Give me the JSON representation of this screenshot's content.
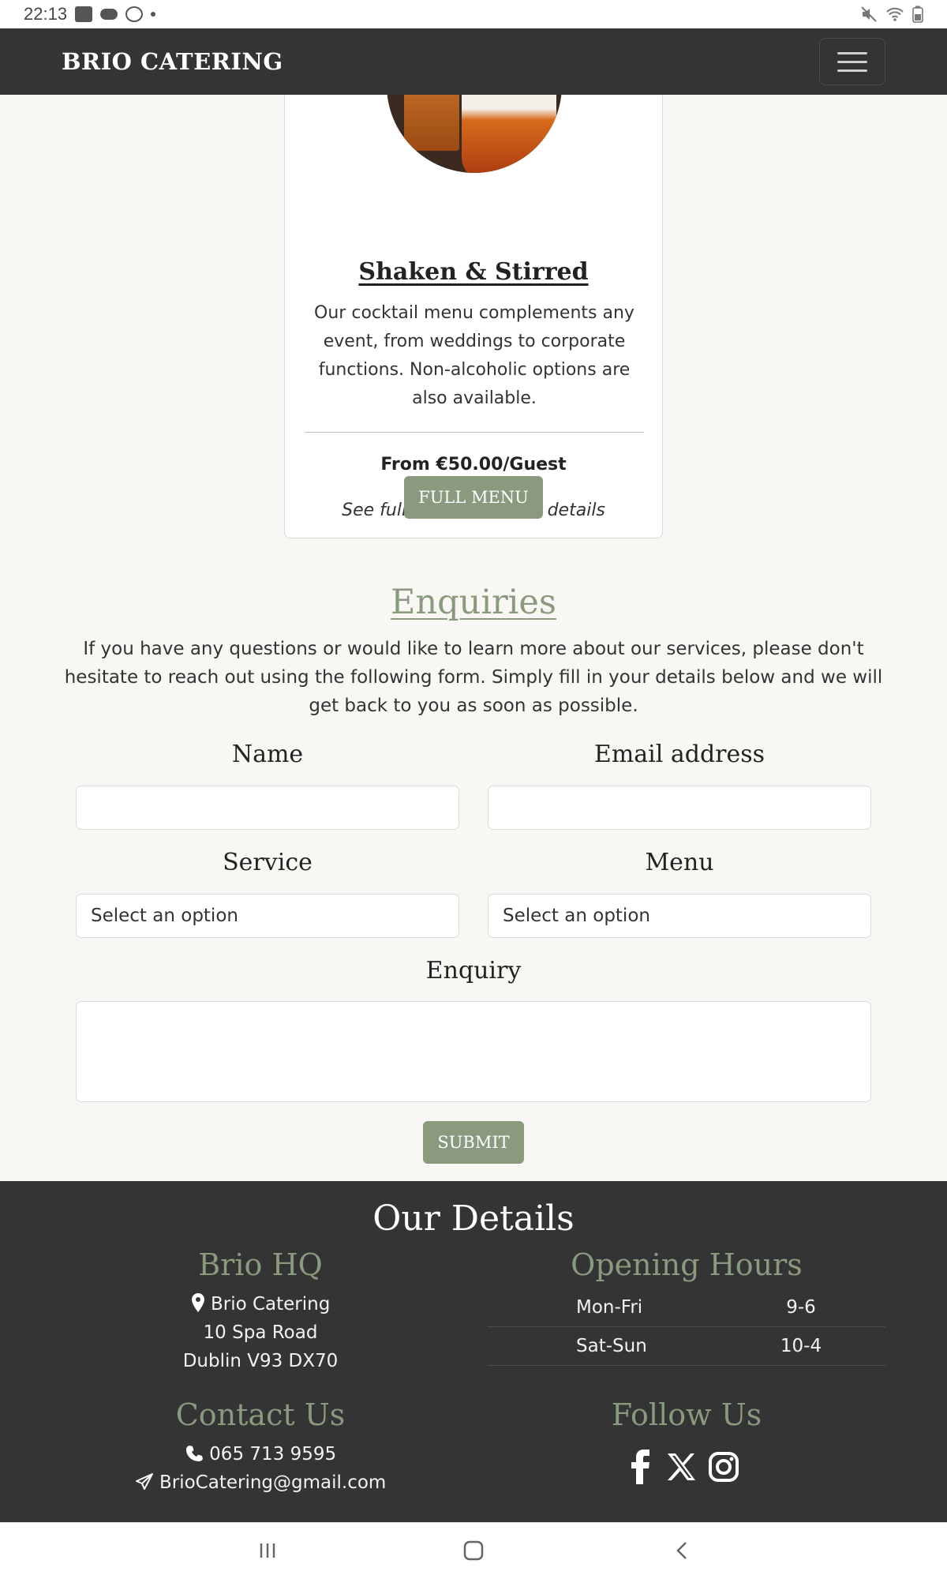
{
  "status_bar": {
    "time": "22:13"
  },
  "navbar": {
    "brand": "BRIO CATERING"
  },
  "menu_card": {
    "title": "Shaken & Stirred",
    "description": "Our cocktail menu complements any event, from weddings to corporate functions. Non-alcoholic options are also available.",
    "price": "From €50.00/Guest",
    "note": "See full menu for more details",
    "button_label": "FULL MENU"
  },
  "enquiries": {
    "title": "Enquiries",
    "intro": "If you have any questions or would like to learn more about our services, please don't hesitate to reach out using the following form. Simply fill in your details below and we will get back to you as soon as possible.",
    "name_label": "Name",
    "email_label": "Email address",
    "service_label": "Service",
    "service_value": "Select an option",
    "menu_label": "Menu",
    "menu_value": "Select an option",
    "enquiry_label": "Enquiry",
    "submit_label": "SUBMIT"
  },
  "footer": {
    "title": "Our Details",
    "hq": {
      "heading": "Brio HQ",
      "lines": [
        "Brio Catering",
        "10 Spa Road",
        "Dublin V93 DX70"
      ]
    },
    "hours": {
      "heading": "Opening Hours",
      "rows": [
        {
          "day": "Mon-Fri",
          "time": "9-6"
        },
        {
          "day": "Sat-Sun",
          "time": "10-4"
        }
      ]
    },
    "contact": {
      "heading": "Contact Us",
      "phone": "065 713 9595",
      "email": "BrioCatering@gmail.com"
    },
    "follow": {
      "heading": "Follow Us",
      "icons": [
        "facebook-icon",
        "x-icon",
        "instagram-icon"
      ]
    }
  },
  "colors": {
    "accent": "#8a9a7f",
    "dark": "#343434",
    "background": "#f8f7f4"
  }
}
